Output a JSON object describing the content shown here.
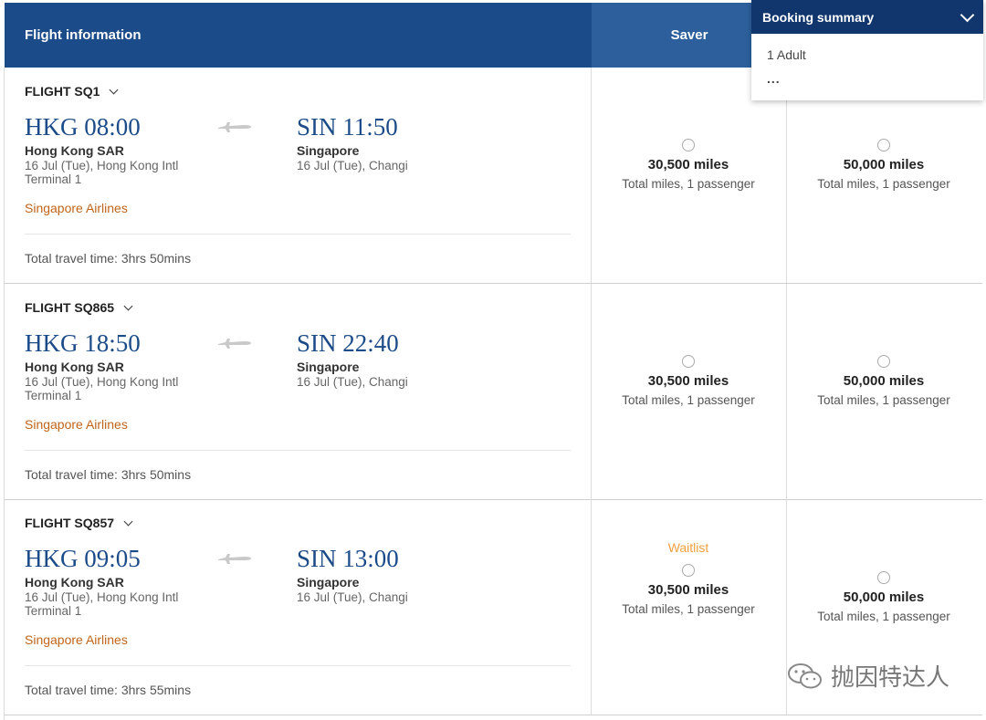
{
  "header": {
    "flight_info": "Flight information",
    "saver": "Saver"
  },
  "summary": {
    "title": "Booking summary",
    "passengers": "1 Adult",
    "more": "..."
  },
  "flights": [
    {
      "label": "FLIGHT SQ1",
      "dep_time": "HKG 08:00",
      "dep_city": "Hong Kong SAR",
      "dep_detail": "16 Jul (Tue), Hong Kong Intl",
      "dep_terminal": "Terminal 1",
      "arr_time": "SIN 11:50",
      "arr_city": "Singapore",
      "arr_detail": "16 Jul (Tue), Changi",
      "airline": "Singapore Airlines",
      "total": "Total travel time: 3hrs 50mins",
      "saver_miles": "30,500 miles",
      "saver_sub": "Total miles, 1 passenger",
      "adv_miles": "50,000 miles",
      "adv_sub": "Total miles, 1 passenger"
    },
    {
      "label": "FLIGHT SQ865",
      "dep_time": "HKG 18:50",
      "dep_city": "Hong Kong SAR",
      "dep_detail": "16 Jul (Tue), Hong Kong Intl",
      "dep_terminal": "Terminal 1",
      "arr_time": "SIN 22:40",
      "arr_city": "Singapore",
      "arr_detail": "16 Jul (Tue), Changi",
      "airline": "Singapore Airlines",
      "total": "Total travel time: 3hrs 50mins",
      "saver_miles": "30,500 miles",
      "saver_sub": "Total miles, 1 passenger",
      "adv_miles": "50,000 miles",
      "adv_sub": "Total miles, 1 passenger"
    },
    {
      "label": "FLIGHT SQ857",
      "dep_time": "HKG 09:05",
      "dep_city": "Hong Kong SAR",
      "dep_detail": "16 Jul (Tue), Hong Kong Intl",
      "dep_terminal": "Terminal 1",
      "arr_time": "SIN 13:00",
      "arr_city": "Singapore",
      "arr_detail": "16 Jul (Tue), Changi",
      "airline": "Singapore Airlines",
      "total": "Total travel time: 3hrs 55mins",
      "saver_status": "Waitlist",
      "saver_miles": "30,500 miles",
      "saver_sub": "Total miles, 1 passenger",
      "adv_miles": "50,000 miles",
      "adv_sub": "Total miles, 1 passenger"
    }
  ],
  "watermark": "抛因特达人",
  "colors": {
    "header_dark": "#1b4b88",
    "header_light": "#2c5f9c",
    "summary_head": "#11366d",
    "airline": "#c0641a",
    "waitlist": "#f0a040"
  }
}
